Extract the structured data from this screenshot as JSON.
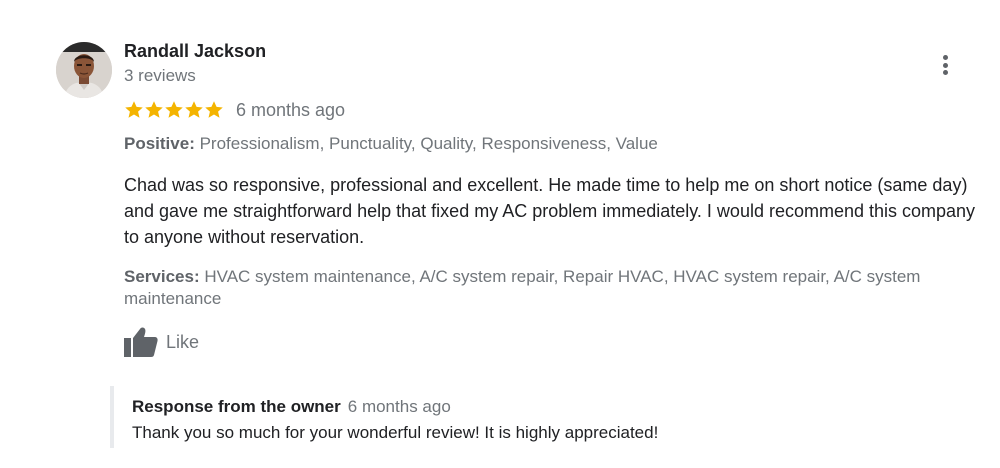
{
  "review": {
    "author": {
      "name": "Randall Jackson",
      "review_count": "3 reviews",
      "avatar_icon": "user-avatar-photo"
    },
    "rating": {
      "stars": 5,
      "max_stars": 5,
      "star_color": "#f4b400",
      "time_ago": "6 months ago"
    },
    "more_options_icon": "vertical-ellipsis-icon",
    "positive": {
      "label": "Positive:",
      "values": "Professionalism, Punctuality, Quality, Responsiveness, Value"
    },
    "text": "Chad was so responsive, professional and excellent. He made time to help me on short notice (same day) and gave me straightforward help that fixed my AC problem immediately. I would recommend this company to anyone without reservation.",
    "services": {
      "label": "Services:",
      "values": "HVAC system maintenance, A/C system repair, Repair HVAC, HVAC system repair, A/C system maintenance"
    },
    "like": {
      "icon": "thumbs-up-icon",
      "label": "Like"
    },
    "owner_response": {
      "title": "Response from the owner",
      "time_ago": "6 months ago",
      "text": "Thank you so much for your wonderful review! It is highly appreciated!"
    }
  },
  "colors": {
    "primary_text": "#202124",
    "secondary_text": "#70757a",
    "star": "#f4b400",
    "response_border": "#e8eaed"
  }
}
